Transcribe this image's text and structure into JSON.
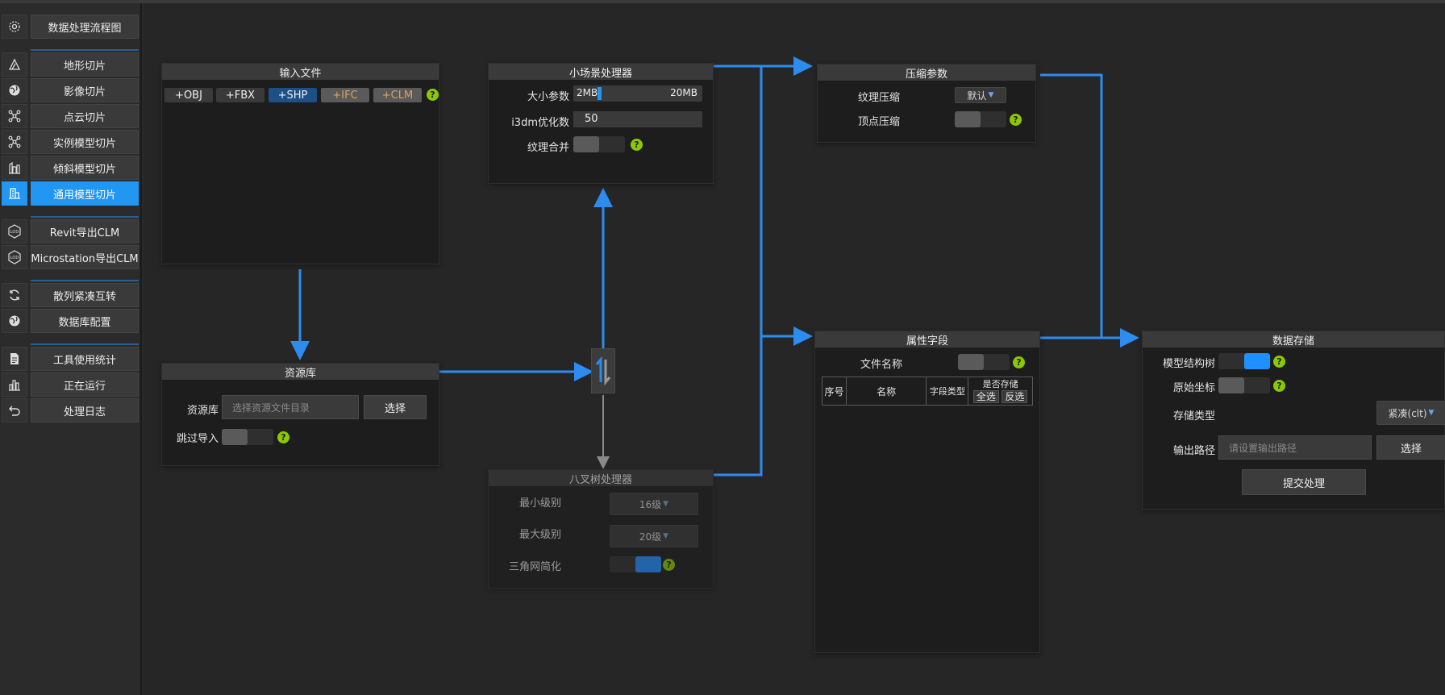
{
  "sidebar": {
    "items": [
      {
        "label": "数据处理流程图",
        "icon": "gear-icon",
        "active": false
      },
      {
        "label": "地形切片",
        "icon": "terrain-icon",
        "active": false
      },
      {
        "label": "影像切片",
        "icon": "globe-icon",
        "active": false
      },
      {
        "label": "点云切片",
        "icon": "pointcloud-icon",
        "active": false
      },
      {
        "label": "实例模型切片",
        "icon": "instance-model-icon",
        "active": false
      },
      {
        "label": "倾斜模型切片",
        "icon": "oblique-model-icon",
        "active": false
      },
      {
        "label": "通用模型切片",
        "icon": "building-icon",
        "active": true
      },
      {
        "label": "Revit导出CLM",
        "icon": "revit-icon",
        "active": false
      },
      {
        "label": "Microstation导出CLM",
        "icon": "microstation-icon",
        "active": false
      },
      {
        "label": "散列紧凑互转",
        "icon": "refresh-icon",
        "active": false
      },
      {
        "label": "数据库配置",
        "icon": "database-globe-icon",
        "active": false
      },
      {
        "label": "工具使用统计",
        "icon": "document-icon",
        "active": false
      },
      {
        "label": "正在运行",
        "icon": "chart-icon",
        "active": false
      },
      {
        "label": "处理日志",
        "icon": "undo-icon",
        "active": false
      }
    ]
  },
  "input_file": {
    "title": "输入文件",
    "chips": [
      {
        "label": "+OBJ",
        "style": "dark"
      },
      {
        "label": "+FBX",
        "style": "dark"
      },
      {
        "label": "+SHP",
        "style": "blue"
      },
      {
        "label": "+IFC",
        "style": "gray-orange"
      },
      {
        "label": "+CLM",
        "style": "gray-orange"
      }
    ]
  },
  "resource_lib": {
    "title": "资源库",
    "lib_label": "资源库",
    "lib_placeholder": "选择资源文件目录",
    "select_label": "选择",
    "skip_label": "跳过导入",
    "skip_on": false
  },
  "small_scene": {
    "title": "小场景处理器",
    "size_label": "大小参数",
    "size_min": "2MB",
    "size_max": "20MB",
    "size_fraction": 0.0,
    "i3dm_label": "i3dm优化数",
    "i3dm_value": "50",
    "merge_label": "纹理合并",
    "merge_on": false
  },
  "octree": {
    "title": "八叉树处理器",
    "min_label": "最小级别",
    "min_value": "16级",
    "max_label": "最大级别",
    "max_value": "20级",
    "simplify_label": "三角网简化",
    "simplify_on": true
  },
  "compress": {
    "title": "压缩参数",
    "texture_label": "纹理压缩",
    "texture_value": "默认",
    "vertex_label": "顶点压缩",
    "vertex_on": false
  },
  "attributes": {
    "title": "属性字段",
    "filename_label": "文件名称",
    "filename_on": false,
    "columns": [
      "序号",
      "名称",
      "字段类型",
      "是否存储"
    ],
    "select_all": "全选",
    "invert": "反选"
  },
  "storage": {
    "title": "数据存储",
    "tree_label": "模型结构树",
    "tree_on": true,
    "coord_label": "原始坐标",
    "coord_on": false,
    "type_label": "存储类型",
    "type_value": "紧凑(clt)",
    "path_label": "输出路径",
    "path_placeholder": "请设置输出路径",
    "select_label": "选择",
    "submit_label": "提交处理"
  },
  "colors": {
    "accent": "#2196f3",
    "wire_active": "#2d8cf0",
    "wire_inactive": "#8a8a8a",
    "help": "#8cc800",
    "orange_text": "#e0a060"
  }
}
